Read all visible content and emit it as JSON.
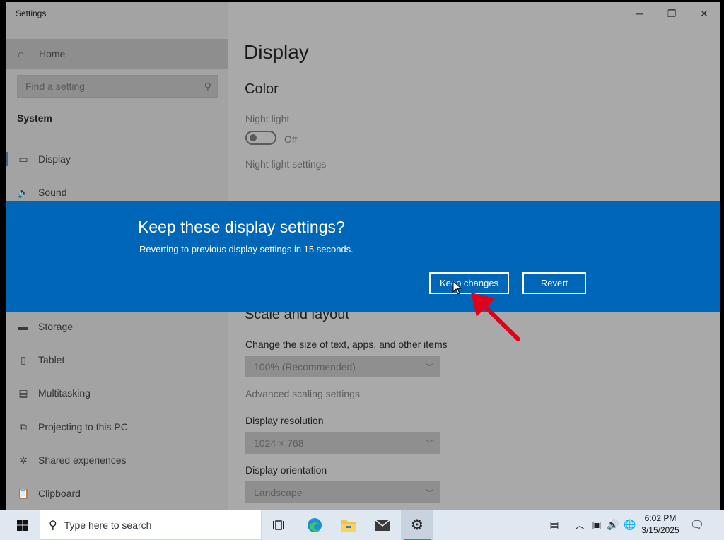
{
  "window": {
    "title": "Settings",
    "minimize_glyph": "─",
    "maximize_glyph": "❐",
    "close_glyph": "✕"
  },
  "sidebar": {
    "home_label": "Home",
    "search_placeholder": "Find a setting",
    "section": "System",
    "items": [
      {
        "label": "Display",
        "icon": "monitor-icon"
      },
      {
        "label": "Sound",
        "icon": "speaker-icon"
      },
      {
        "label": "Storage",
        "icon": "storage-icon"
      },
      {
        "label": "Tablet",
        "icon": "tablet-icon"
      },
      {
        "label": "Multitasking",
        "icon": "multitasking-icon"
      },
      {
        "label": "Projecting to this PC",
        "icon": "projector-icon"
      },
      {
        "label": "Shared experiences",
        "icon": "share-icon"
      },
      {
        "label": "Clipboard",
        "icon": "clipboard-icon"
      }
    ]
  },
  "main": {
    "title": "Display",
    "color_heading": "Color",
    "night_light_label": "Night light",
    "night_light_state": "Off",
    "night_light_settings": "Night light settings",
    "scale_heading": "Scale and layout",
    "scale_label": "Change the size of text, apps, and other items",
    "scale_value": "100% (Recommended)",
    "advanced_scaling": "Advanced scaling settings",
    "resolution_label": "Display resolution",
    "resolution_value": "1024 × 768",
    "orientation_label": "Display orientation",
    "orientation_value": "Landscape"
  },
  "dialog": {
    "title": "Keep these display settings?",
    "message": "Reverting to previous display settings in 15 seconds.",
    "keep_label": "Keep changes",
    "revert_label": "Revert"
  },
  "taskbar": {
    "search_placeholder": "Type here to search",
    "time": "6:02 PM",
    "date": "3/15/2025"
  },
  "colors": {
    "dialog_bg": "#0067b8",
    "annotation_arrow": "#e0001a"
  }
}
